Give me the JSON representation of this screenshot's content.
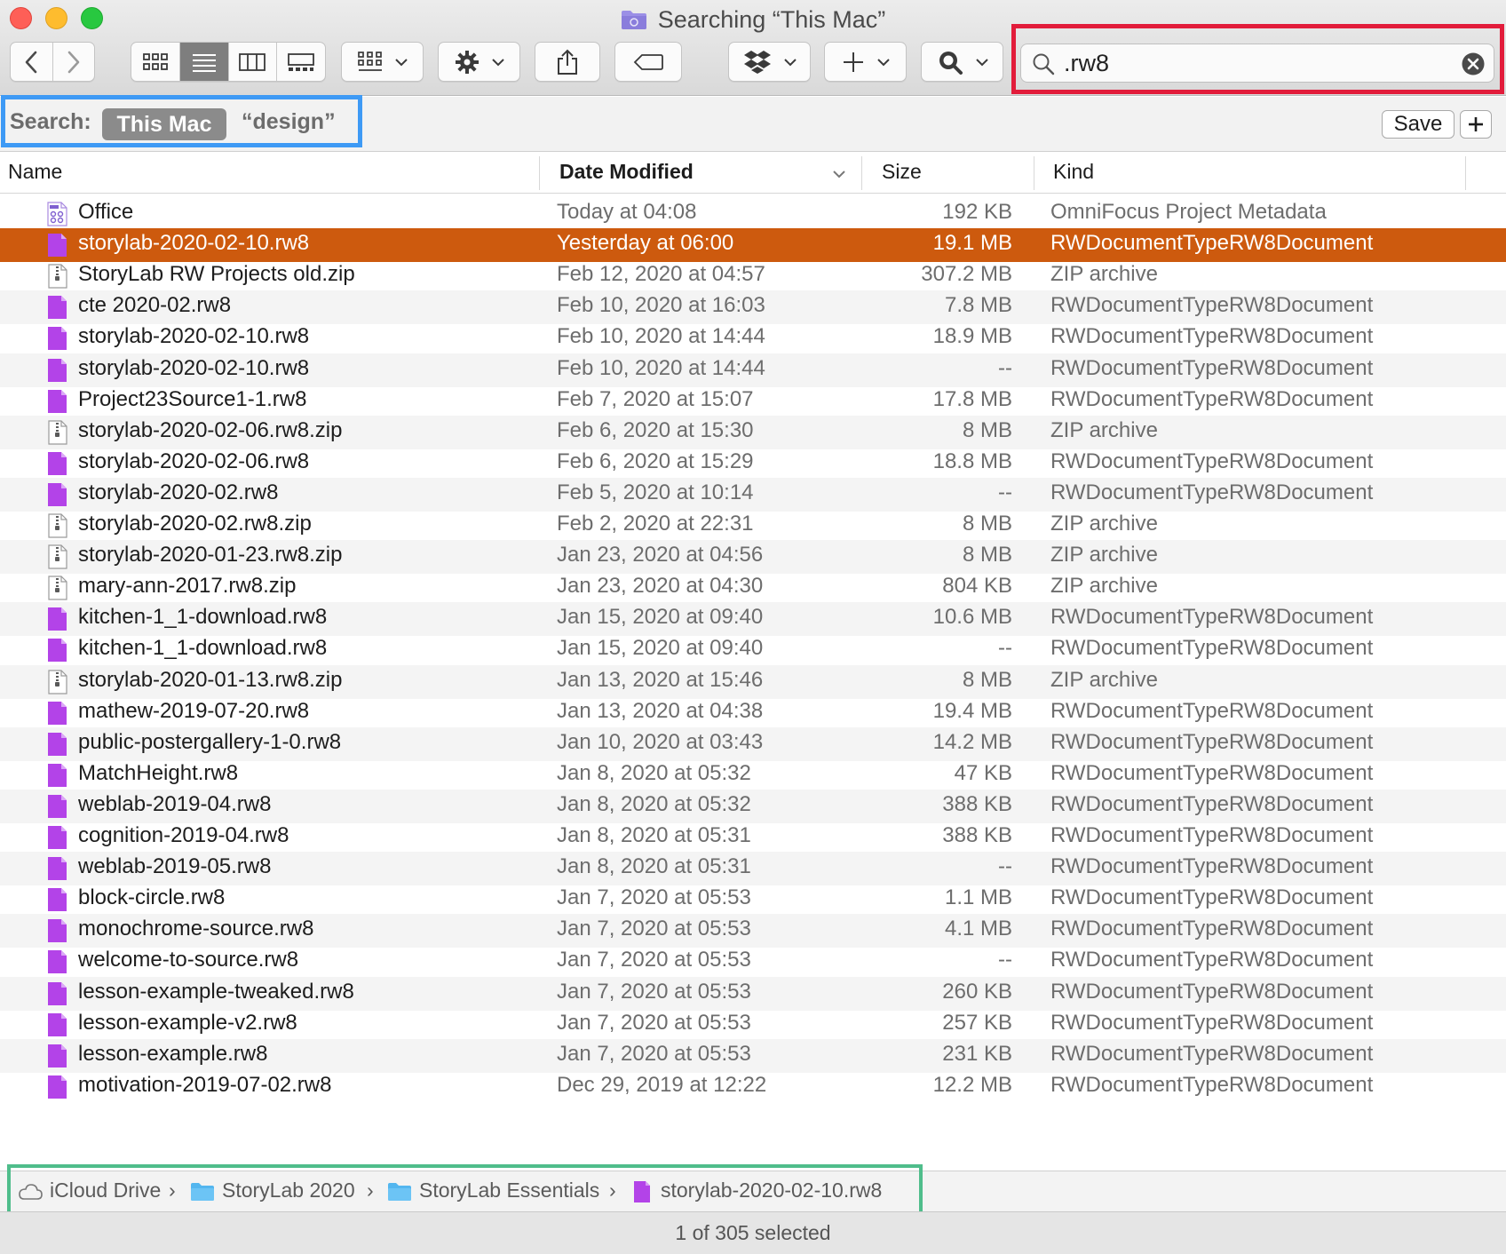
{
  "window": {
    "title": "Searching “This Mac”"
  },
  "search": {
    "query": ".rw8"
  },
  "scope": {
    "label": "Search:",
    "this_mac": "This Mac",
    "design": "“design”",
    "save_label": "Save"
  },
  "columns": {
    "name": "Name",
    "date": "Date Modified",
    "size": "Size",
    "kind": "Kind"
  },
  "files": [
    {
      "name": "Office",
      "date": "Today at 04:08",
      "size": "192 KB",
      "kind": "OmniFocus Project Metadata",
      "icon": "omnifocus-doc-icon"
    },
    {
      "name": "storylab-2020-02-10.rw8",
      "date": "Yesterday at 06:00",
      "size": "19.1 MB",
      "kind": "RWDocumentTypeRW8Document",
      "icon": "rw8-doc-icon",
      "selected": true
    },
    {
      "name": "StoryLab RW Projects old.zip",
      "date": "Feb 12, 2020 at 04:57",
      "size": "307.2 MB",
      "kind": "ZIP archive",
      "icon": "zip-icon"
    },
    {
      "name": "cte 2020-02.rw8",
      "date": "Feb 10, 2020 at 16:03",
      "size": "7.8 MB",
      "kind": "RWDocumentTypeRW8Document",
      "icon": "rw8-doc-icon"
    },
    {
      "name": "storylab-2020-02-10.rw8",
      "date": "Feb 10, 2020 at 14:44",
      "size": "18.9 MB",
      "kind": "RWDocumentTypeRW8Document",
      "icon": "rw8-doc-icon"
    },
    {
      "name": "storylab-2020-02-10.rw8",
      "date": "Feb 10, 2020 at 14:44",
      "size": "--",
      "kind": "RWDocumentTypeRW8Document",
      "icon": "rw8-doc-icon"
    },
    {
      "name": "Project23Source1-1.rw8",
      "date": "Feb 7, 2020 at 15:07",
      "size": "17.8 MB",
      "kind": "RWDocumentTypeRW8Document",
      "icon": "rw8-doc-icon"
    },
    {
      "name": "storylab-2020-02-06.rw8.zip",
      "date": "Feb 6, 2020 at 15:30",
      "size": "8 MB",
      "kind": "ZIP archive",
      "icon": "zip-icon"
    },
    {
      "name": "storylab-2020-02-06.rw8",
      "date": "Feb 6, 2020 at 15:29",
      "size": "18.8 MB",
      "kind": "RWDocumentTypeRW8Document",
      "icon": "rw8-doc-icon"
    },
    {
      "name": "storylab-2020-02.rw8",
      "date": "Feb 5, 2020 at 10:14",
      "size": "--",
      "kind": "RWDocumentTypeRW8Document",
      "icon": "rw8-doc-icon"
    },
    {
      "name": "storylab-2020-02.rw8.zip",
      "date": "Feb 2, 2020 at 22:31",
      "size": "8 MB",
      "kind": "ZIP archive",
      "icon": "zip-icon"
    },
    {
      "name": "storylab-2020-01-23.rw8.zip",
      "date": "Jan 23, 2020 at 04:56",
      "size": "8 MB",
      "kind": "ZIP archive",
      "icon": "zip-icon"
    },
    {
      "name": "mary-ann-2017.rw8.zip",
      "date": "Jan 23, 2020 at 04:30",
      "size": "804 KB",
      "kind": "ZIP archive",
      "icon": "zip-icon"
    },
    {
      "name": "kitchen-1_1-download.rw8",
      "date": "Jan 15, 2020 at 09:40",
      "size": "10.6 MB",
      "kind": "RWDocumentTypeRW8Document",
      "icon": "rw8-doc-icon"
    },
    {
      "name": "kitchen-1_1-download.rw8",
      "date": "Jan 15, 2020 at 09:40",
      "size": "--",
      "kind": "RWDocumentTypeRW8Document",
      "icon": "rw8-doc-icon"
    },
    {
      "name": "storylab-2020-01-13.rw8.zip",
      "date": "Jan 13, 2020 at 15:46",
      "size": "8 MB",
      "kind": "ZIP archive",
      "icon": "zip-icon"
    },
    {
      "name": "mathew-2019-07-20.rw8",
      "date": "Jan 13, 2020 at 04:38",
      "size": "19.4 MB",
      "kind": "RWDocumentTypeRW8Document",
      "icon": "rw8-doc-icon"
    },
    {
      "name": "public-postergallery-1-0.rw8",
      "date": "Jan 10, 2020 at 03:43",
      "size": "14.2 MB",
      "kind": "RWDocumentTypeRW8Document",
      "icon": "rw8-doc-icon"
    },
    {
      "name": "MatchHeight.rw8",
      "date": "Jan 8, 2020 at 05:32",
      "size": "47 KB",
      "kind": "RWDocumentTypeRW8Document",
      "icon": "rw8-doc-icon"
    },
    {
      "name": "weblab-2019-04.rw8",
      "date": "Jan 8, 2020 at 05:32",
      "size": "388 KB",
      "kind": "RWDocumentTypeRW8Document",
      "icon": "rw8-doc-icon"
    },
    {
      "name": "cognition-2019-04.rw8",
      "date": "Jan 8, 2020 at 05:31",
      "size": "388 KB",
      "kind": "RWDocumentTypeRW8Document",
      "icon": "rw8-doc-icon"
    },
    {
      "name": "weblab-2019-05.rw8",
      "date": "Jan 8, 2020 at 05:31",
      "size": "--",
      "kind": "RWDocumentTypeRW8Document",
      "icon": "rw8-doc-icon"
    },
    {
      "name": "block-circle.rw8",
      "date": "Jan 7, 2020 at 05:53",
      "size": "1.1 MB",
      "kind": "RWDocumentTypeRW8Document",
      "icon": "rw8-doc-icon"
    },
    {
      "name": "monochrome-source.rw8",
      "date": "Jan 7, 2020 at 05:53",
      "size": "4.1 MB",
      "kind": "RWDocumentTypeRW8Document",
      "icon": "rw8-doc-icon"
    },
    {
      "name": "welcome-to-source.rw8",
      "date": "Jan 7, 2020 at 05:53",
      "size": "--",
      "kind": "RWDocumentTypeRW8Document",
      "icon": "rw8-doc-icon"
    },
    {
      "name": "lesson-example-tweaked.rw8",
      "date": "Jan 7, 2020 at 05:53",
      "size": "260 KB",
      "kind": "RWDocumentTypeRW8Document",
      "icon": "rw8-doc-icon"
    },
    {
      "name": "lesson-example-v2.rw8",
      "date": "Jan 7, 2020 at 05:53",
      "size": "257 KB",
      "kind": "RWDocumentTypeRW8Document",
      "icon": "rw8-doc-icon"
    },
    {
      "name": "lesson-example.rw8",
      "date": "Jan 7, 2020 at 05:53",
      "size": "231 KB",
      "kind": "RWDocumentTypeRW8Document",
      "icon": "rw8-doc-icon"
    },
    {
      "name": "motivation-2019-07-02.rw8",
      "date": "Dec 29, 2019 at 12:22",
      "size": "12.2 MB",
      "kind": "RWDocumentTypeRW8Document",
      "icon": "rw8-doc-icon"
    }
  ],
  "path": {
    "icloud": "iCloud Drive",
    "folder1": "StoryLab 2020",
    "folder2": "StoryLab Essentials",
    "file": "storylab-2020-02-10.rw8",
    "separator": "›"
  },
  "status": {
    "text": "1 of 305 selected"
  },
  "colors": {
    "selection": "#cd5a0e",
    "rw8_purple": "#b343e8",
    "highlight_red": "#e21c3b",
    "highlight_blue": "#3e9af5",
    "highlight_green": "#4fbd8b",
    "folder_blue": "#53b6ef"
  }
}
